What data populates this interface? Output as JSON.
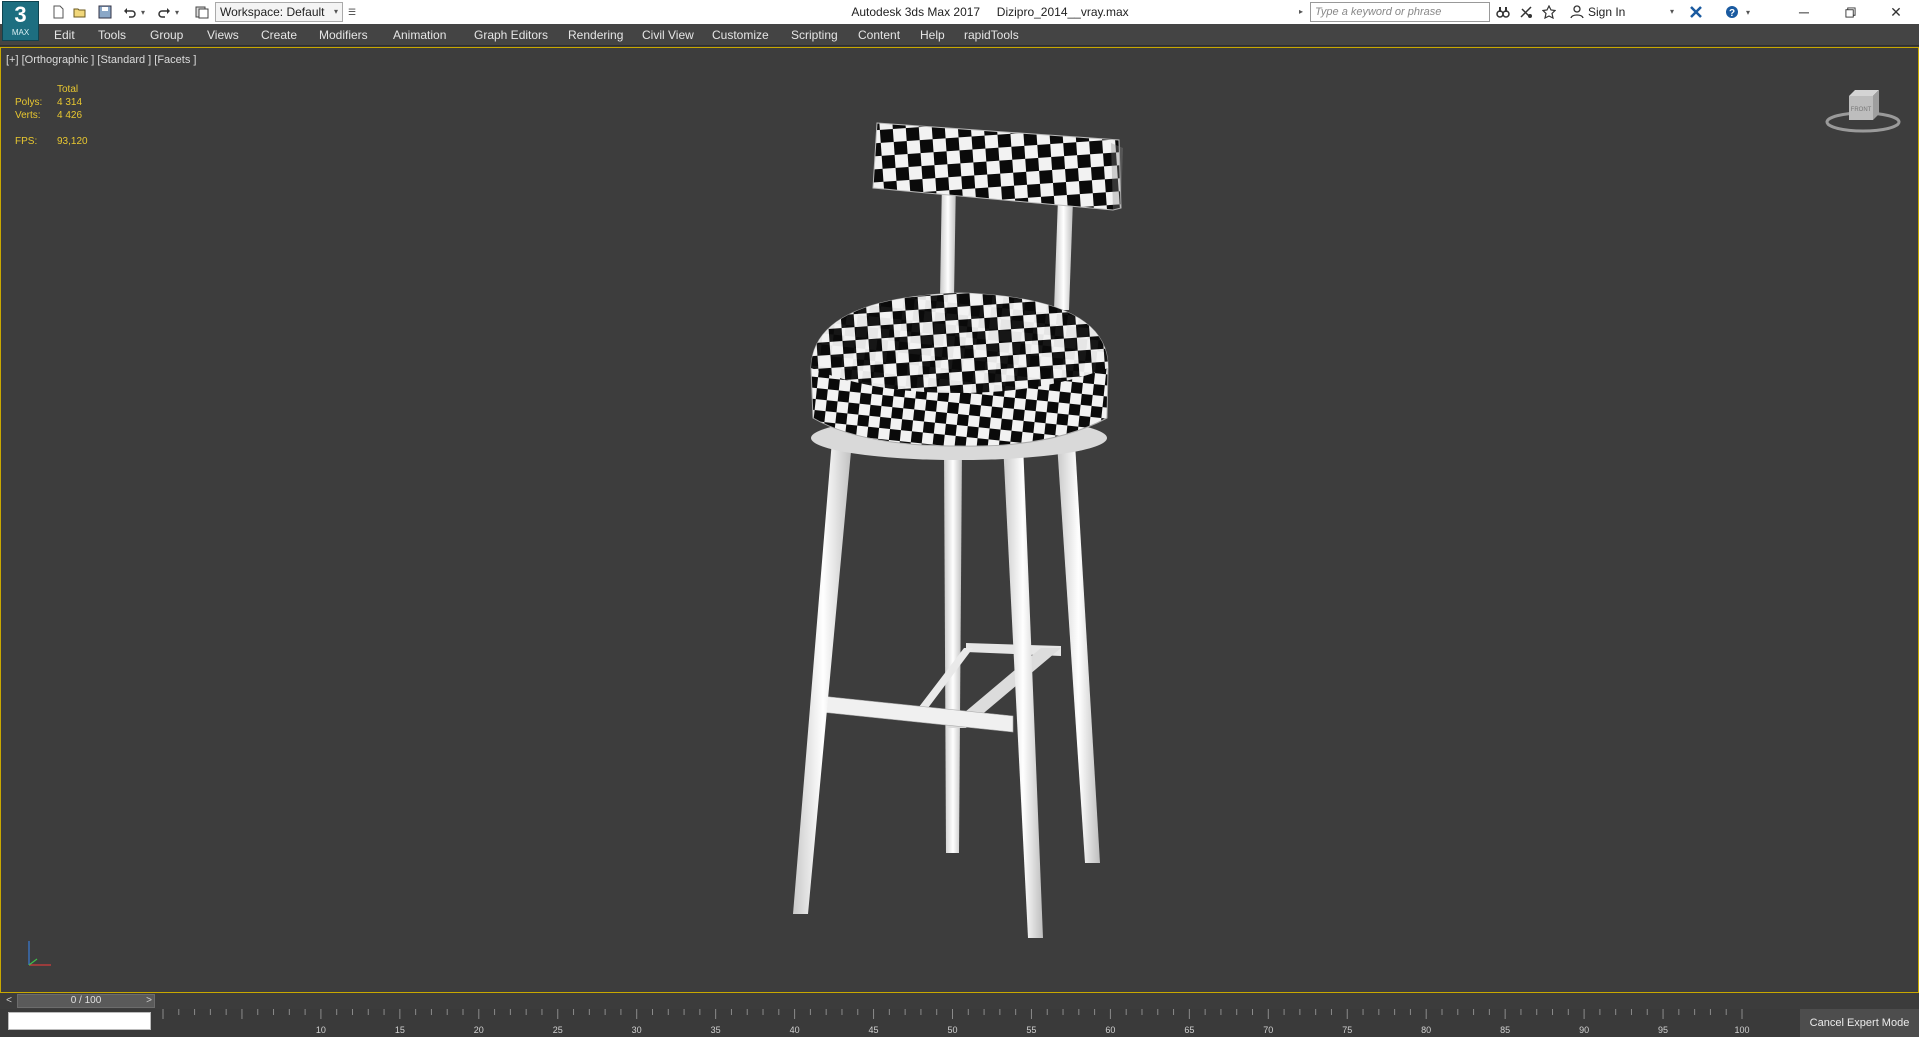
{
  "titlebar": {
    "app_logo_number": "3",
    "app_logo_sub": "MAX",
    "workspace_label": "Workspace: Default",
    "title": "Autodesk 3ds Max 2017     Dizipro_2014__vray.max",
    "search_placeholder": "Type a keyword or phrase",
    "sign_in": "Sign In"
  },
  "menu": {
    "items": [
      "Edit",
      "Tools",
      "Group",
      "Views",
      "Create",
      "Modifiers",
      "Animation",
      "Graph Editors",
      "Rendering",
      "Civil View",
      "Customize",
      "Scripting",
      "Content",
      "Help",
      "rapidTools"
    ]
  },
  "viewport": {
    "label": "[+] [Orthographic ] [Standard ] [Facets ]",
    "stats": {
      "header": "Total",
      "polys_label": "Polys:",
      "polys_value": "4 314",
      "verts_label": "Verts:",
      "verts_value": "4 426",
      "fps_label": "FPS:",
      "fps_value": "93,120"
    },
    "viewcube_label": "FRONT"
  },
  "timeline": {
    "prev": "<",
    "position": "0 / 100",
    "next": ">",
    "ticks": [
      "10",
      "15",
      "20",
      "25",
      "30",
      "35",
      "40",
      "45",
      "50",
      "55",
      "60",
      "65",
      "70",
      "75",
      "80",
      "85",
      "90",
      "95",
      "100"
    ]
  },
  "statusbar": {
    "expert_mode": "Cancel Expert Mode"
  },
  "colors": {
    "viewport_bg": "#3d3d3d",
    "active_border": "#c8a800",
    "stats_text": "#e8c730",
    "menubar_bg": "#444444"
  }
}
